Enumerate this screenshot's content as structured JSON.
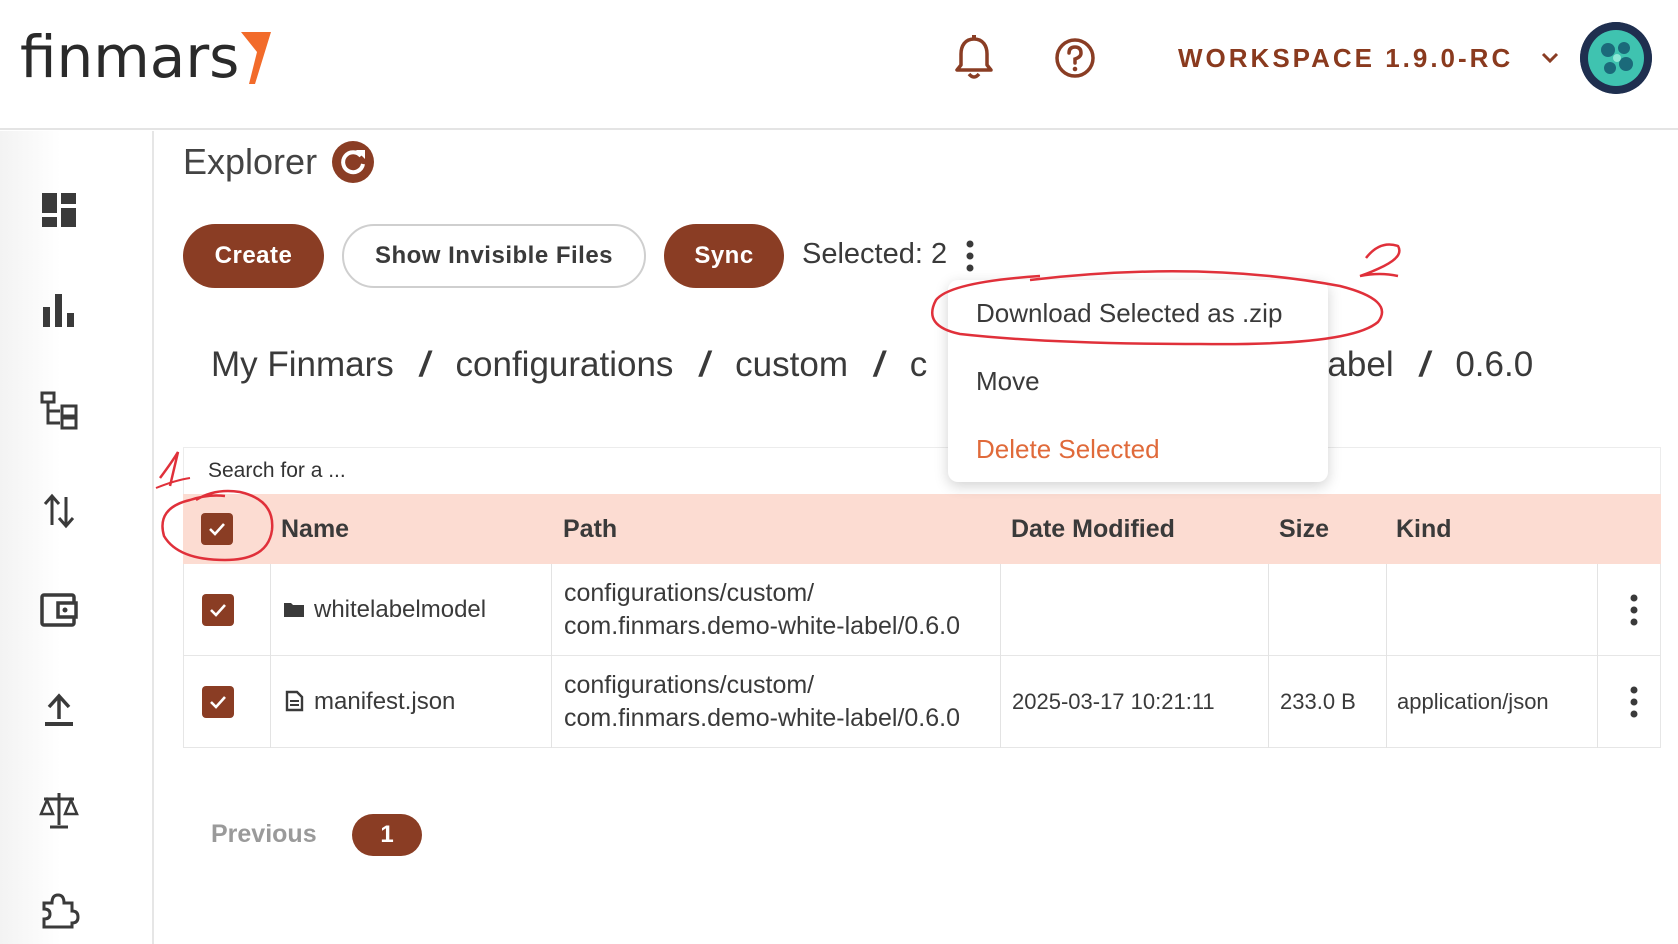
{
  "header": {
    "logo_text": "finmars",
    "workspace_label": "WORKSPACE 1.9.0-RC",
    "accent_color": "#8a3d24",
    "logo_accent_color": "#f26b2a"
  },
  "sidebar": {
    "items": [
      {
        "icon": "dashboard-icon"
      },
      {
        "icon": "bar-chart-icon"
      },
      {
        "icon": "hierarchy-icon"
      },
      {
        "icon": "transfer-arrows-icon"
      },
      {
        "icon": "wallet-icon"
      },
      {
        "icon": "upload-icon"
      },
      {
        "icon": "scale-icon"
      },
      {
        "icon": "puzzle-icon"
      }
    ]
  },
  "main": {
    "title": "Explorer",
    "toolbar": {
      "create_label": "Create",
      "show_invisible_label": "Show Invisible Files",
      "sync_label": "Sync",
      "selected_label": "Selected: 2"
    },
    "breadcrumb": {
      "items": [
        "My Finmars",
        "configurations",
        "custom",
        "c",
        "-label",
        "0.6.0"
      ],
      "separator": "/"
    },
    "menu": {
      "items": [
        {
          "label": "Download Selected as .zip",
          "color": "#3a3a3a"
        },
        {
          "label": "Move",
          "color": "#3a3a3a"
        },
        {
          "label": "Delete Selected",
          "color": "#e06a3a"
        }
      ]
    },
    "table": {
      "search_placeholder": "Search for a ...",
      "header_bg": "#fcdcd2",
      "columns": [
        "Name",
        "Path",
        "Date Modified",
        "Size",
        "Kind"
      ],
      "rows": [
        {
          "type": "folder-icon",
          "name": "whitelabelmodel",
          "path_line1": "configurations/custom/",
          "path_line2": "com.finmars.demo-white-label/0.6.0",
          "date": "",
          "size": "",
          "kind": ""
        },
        {
          "type": "file-icon",
          "name": "manifest.json",
          "path_line1": "configurations/custom/",
          "path_line2": "com.finmars.demo-white-label/0.6.0",
          "date": "2025-03-17 10:21:11",
          "size": "233.0 B",
          "kind": "application/json"
        }
      ]
    },
    "pagination": {
      "previous_label": "Previous",
      "current_page": "1"
    }
  },
  "annotations": {
    "color": "#e0303a",
    "marks": [
      "1",
      "2"
    ]
  }
}
